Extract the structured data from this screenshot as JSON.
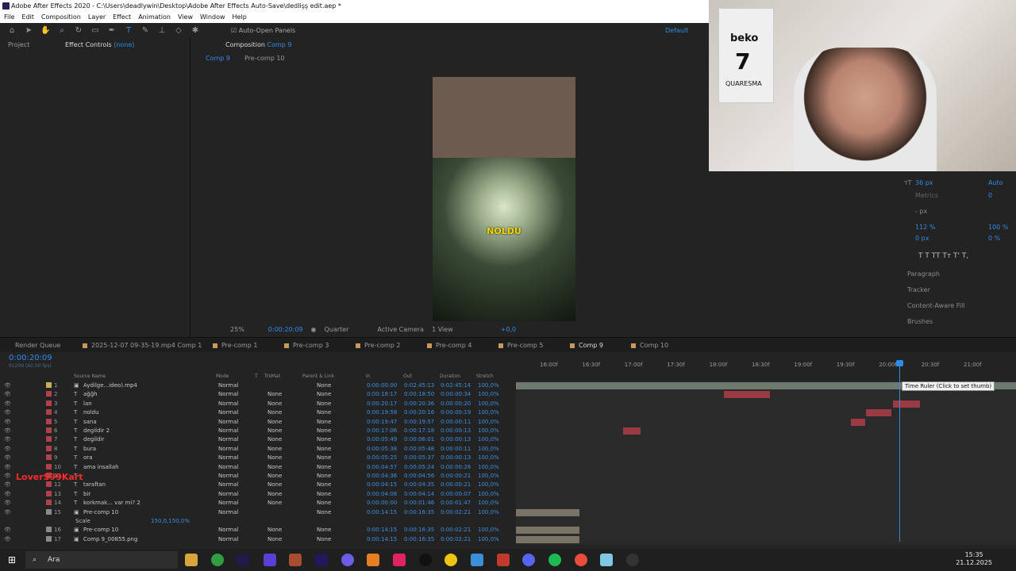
{
  "app": {
    "title": "Adobe After Effects 2020 - C:\\Users\\deadlywin\\Desktop\\Adobe After Effects Auto-Save\\dedlişş edit.aep *"
  },
  "menu": [
    "File",
    "Edit",
    "Composition",
    "Layer",
    "Effect",
    "Animation",
    "View",
    "Window",
    "Help"
  ],
  "toolbar": {
    "auto_open": "Auto-Open Panels",
    "workspace": "Default"
  },
  "left_panel": {
    "project": "Project",
    "effect_controls": "Effect Controls",
    "effect_target": "(none)"
  },
  "viewer": {
    "tab_label": "Composition",
    "comp_name": "Comp 9",
    "sub_tabs": [
      "Comp 9",
      "Pre-comp 10"
    ],
    "caption": "NOLDU",
    "zoom": "25%",
    "time": "0:00:20:09",
    "resolution": "Quarter",
    "camera": "Active Camera",
    "views": "1 View",
    "exposure": "+0,0"
  },
  "webcam": {
    "brand": "beko",
    "number": "7",
    "name": "QUARESMA"
  },
  "character": {
    "size": "36 px",
    "leading": "Auto",
    "kerning": "Metrics",
    "tracking": "0",
    "stroke": "- px",
    "vscale": "112 %",
    "hscale": "100 %",
    "baseline": "0 px",
    "tsume": "0 %",
    "styles": "T  T  TT  Tт  T'  T,",
    "sections": [
      "Paragraph",
      "Tracker",
      "Content-Aware Fill",
      "Brushes"
    ]
  },
  "timeline": {
    "tabs": [
      "Render Queue",
      "2025-12-07 09-35-19.mp4 Comp 1",
      "Pre-comp 1",
      "Pre-comp 3",
      "Pre-comp 2",
      "Pre-comp 4",
      "Pre-comp 5",
      "Comp 9",
      "Comp 10"
    ],
    "timecode": "0:00:20:09",
    "frame_info": "01209 (60.00 fps)",
    "columns": {
      "source": "Source Name",
      "mode": "Mode",
      "t": "T",
      "trkmat": "TrkMat",
      "parent": "Parent & Link",
      "in": "In",
      "out": "Out",
      "duration": "Duration",
      "stretch": "Stretch"
    },
    "ruler": [
      "16:00f",
      "16:30f",
      "17:00f",
      "17:30f",
      "18:00f",
      "18:30f",
      "19:00f",
      "19:30f",
      "20:00f",
      "20:30f",
      "21:00f"
    ],
    "tooltip": "Time Ruler (Click to set thumb)",
    "scale_prop": "Scale",
    "scale_val": "150,0,150,0%",
    "layers": [
      {
        "n": "1",
        "name": "Aydilge...ideo).mp4",
        "mode": "Normal",
        "trk": "",
        "parent": "None",
        "in": "0:00:00:00",
        "out": "0:02:45:13",
        "dur": "0:02:45:14",
        "str": "100,0%"
      },
      {
        "n": "2",
        "name": "ağğh",
        "mode": "Normal",
        "trk": "None",
        "parent": "None",
        "in": "0:00:18:17",
        "out": "0:00:18:50",
        "dur": "0:00:00:34",
        "str": "100,0%"
      },
      {
        "n": "3",
        "name": "lan",
        "mode": "Normal",
        "trk": "None",
        "parent": "None",
        "in": "0:00:20:17",
        "out": "0:00:20:36",
        "dur": "0:00:00:20",
        "str": "100,0%"
      },
      {
        "n": "4",
        "name": "noldu",
        "mode": "Normal",
        "trk": "None",
        "parent": "None",
        "in": "0:00:19:58",
        "out": "0:00:20:16",
        "dur": "0:00:00:19",
        "str": "100,0%"
      },
      {
        "n": "5",
        "name": "sana",
        "mode": "Normal",
        "trk": "None",
        "parent": "None",
        "in": "0:00:19:47",
        "out": "0:00:19:57",
        "dur": "0:00:00:11",
        "str": "100,0%"
      },
      {
        "n": "6",
        "name": "degildir 2",
        "mode": "Normal",
        "trk": "None",
        "parent": "None",
        "in": "0:00:17:06",
        "out": "0:00:17:18",
        "dur": "0:00:00:13",
        "str": "100,0%"
      },
      {
        "n": "7",
        "name": "degildir",
        "mode": "Normal",
        "trk": "None",
        "parent": "None",
        "in": "0:00:05:49",
        "out": "0:00:06:01",
        "dur": "0:00:00:13",
        "str": "100,0%"
      },
      {
        "n": "8",
        "name": "bura",
        "mode": "Normal",
        "trk": "None",
        "parent": "None",
        "in": "0:00:05:38",
        "out": "0:00:05:48",
        "dur": "0:00:00:11",
        "str": "100,0%"
      },
      {
        "n": "9",
        "name": "ora",
        "mode": "Normal",
        "trk": "None",
        "parent": "None",
        "in": "0:00:05:25",
        "out": "0:00:05:37",
        "dur": "0:00:00:13",
        "str": "100,0%"
      },
      {
        "n": "10",
        "name": "ama insallah",
        "mode": "Normal",
        "trk": "None",
        "parent": "None",
        "in": "0:00:04:57",
        "out": "0:00:05:24",
        "dur": "0:00:00:28",
        "str": "100,0%"
      },
      {
        "n": "11",
        "name": "",
        "mode": "Normal",
        "trk": "None",
        "parent": "None",
        "in": "0:00:04:36",
        "out": "0:00:04:56",
        "dur": "0:00:00:21",
        "str": "100,0%"
      },
      {
        "n": "12",
        "name": "taraftan",
        "mode": "Normal",
        "trk": "None",
        "parent": "None",
        "in": "0:00:04:15",
        "out": "0:00:04:35",
        "dur": "0:00:00:21",
        "str": "100,0%"
      },
      {
        "n": "13",
        "name": "bir",
        "mode": "Normal",
        "trk": "None",
        "parent": "None",
        "in": "0:00:04:08",
        "out": "0:00:04:14",
        "dur": "0:00:00:07",
        "str": "100,0%"
      },
      {
        "n": "14",
        "name": "korkmak... var mi? 2",
        "mode": "Normal",
        "trk": "None",
        "parent": "None",
        "in": "0:00:00:00",
        "out": "0:00:01:46",
        "dur": "0:00:01:47",
        "str": "100,0%"
      },
      {
        "n": "15",
        "name": "Pre-comp 10",
        "mode": "Normal",
        "trk": "",
        "parent": "None",
        "in": "0:00:14:15",
        "out": "0:00:16:35",
        "dur": "0:00:02:21",
        "str": "100,0%"
      },
      {
        "n": "16",
        "name": "Pre-comp 10",
        "mode": "Normal",
        "trk": "None",
        "parent": "None",
        "in": "0:00:14:15",
        "out": "0:00:16:35",
        "dur": "0:00:02:21",
        "str": "100,0%"
      },
      {
        "n": "17",
        "name": "Comp 9_00855.png",
        "mode": "Normal",
        "trk": "None",
        "parent": "None",
        "in": "0:00:14:15",
        "out": "0:00:16:35",
        "dur": "0:00:02:21",
        "str": "100,0%"
      }
    ]
  },
  "overlay_text": "LoverS99Kart",
  "taskbar": {
    "search": "Ara",
    "time": "15:35",
    "date": "21.12.2025"
  }
}
